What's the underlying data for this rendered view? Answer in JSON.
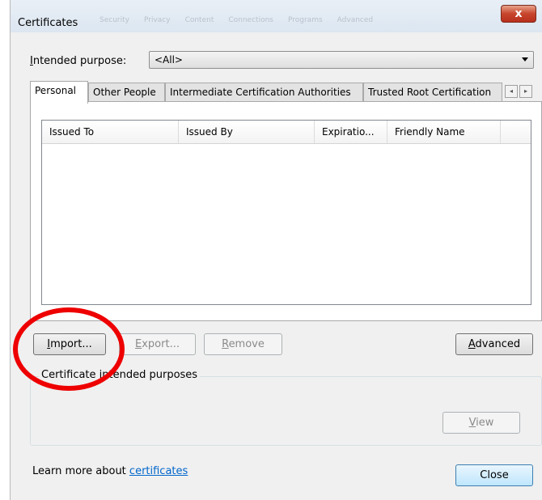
{
  "window": {
    "title": "Certificates",
    "close_glyph": "x",
    "background_tabs": [
      "Security",
      "Privacy",
      "Content",
      "Connections",
      "Programs",
      "Advanced"
    ]
  },
  "purpose": {
    "label_prefix": "I",
    "label_rest": "ntended purpose:",
    "value": "<All>"
  },
  "tabs": [
    {
      "label": "Personal",
      "active": true
    },
    {
      "label": "Other People"
    },
    {
      "label": "Intermediate Certification Authorities"
    },
    {
      "label": "Trusted Root Certification"
    }
  ],
  "tab_scroll": {
    "left": "◂",
    "right": "▸"
  },
  "list": {
    "columns": [
      "Issued To",
      "Issued By",
      "Expiratio...",
      "Friendly Name"
    ],
    "rows": []
  },
  "buttons": {
    "import": {
      "mnemonic": "I",
      "rest": "mport..."
    },
    "export": {
      "mnemonic": "E",
      "rest": "xport..."
    },
    "remove": {
      "mnemonic": "R",
      "rest": "emove"
    },
    "advanced": {
      "mnemonic": "A",
      "rest": "dvanced"
    },
    "view": {
      "mnemonic": "V",
      "rest": "iew"
    },
    "close": {
      "label": "Close"
    }
  },
  "purposes_group": {
    "title": "Certificate intended purposes"
  },
  "footer": {
    "text": "Learn more about ",
    "link": "certificates"
  },
  "colors": {
    "annotation": "#e00000",
    "link": "#0066cc"
  }
}
